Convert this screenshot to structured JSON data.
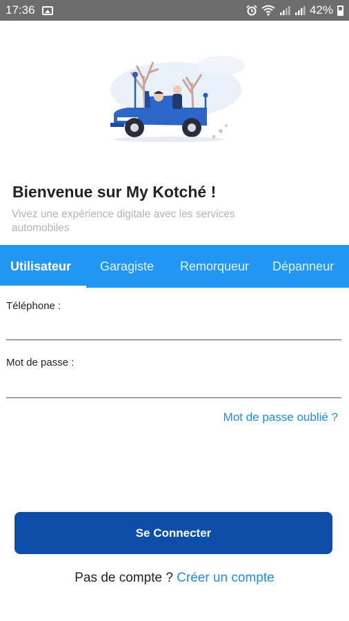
{
  "status_bar": {
    "time": "17:36",
    "battery_percent": "42%",
    "icons": [
      "image-icon",
      "alarm-icon",
      "wifi-icon",
      "signal-icon",
      "signal-icon",
      "battery-icon"
    ]
  },
  "welcome": {
    "title": "Bienvenue sur My Kotché !",
    "subtitle": "Vivez une expérience digitale avec les services automobiles"
  },
  "tabs": [
    {
      "label": "Utilisateur",
      "active": true
    },
    {
      "label": "Garagiste",
      "active": false
    },
    {
      "label": "Remorqueur",
      "active": false
    },
    {
      "label": "Dépanneur",
      "active": false
    }
  ],
  "form": {
    "phone_label": "Téléphone :",
    "phone_value": "",
    "password_label": "Mot de passe :",
    "password_value": "",
    "forgot_password": "Mot de passe oublié ?",
    "submit_label": "Se Connecter"
  },
  "signup": {
    "question": "Pas de compte ?",
    "link": "Créer un compte"
  },
  "colors": {
    "primary": "#2196f3",
    "button": "#0d4fa8",
    "link": "#1a8fe0",
    "statusbar": "#6d6d6d"
  }
}
